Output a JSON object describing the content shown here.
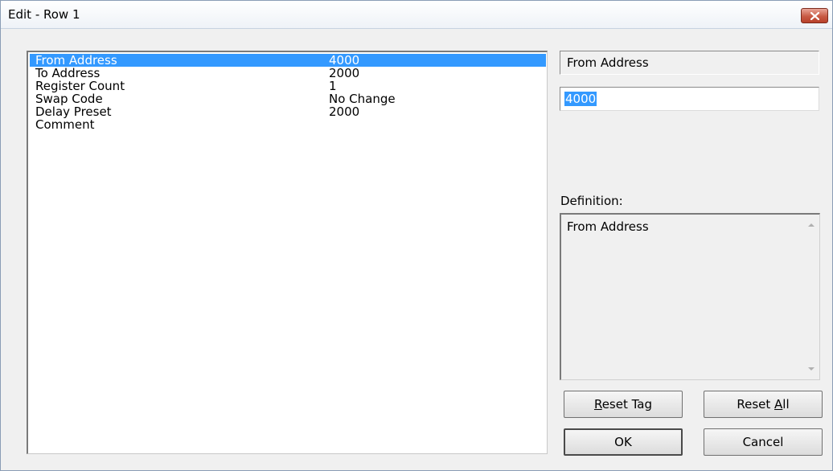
{
  "window": {
    "title": "Edit - Row 1"
  },
  "icons": {
    "close": "close-icon",
    "scroll_up": "scroll-up-arrow-icon",
    "scroll_down": "scroll-down-arrow-icon"
  },
  "colors": {
    "selection": "#3399ff",
    "close_button": "#c85a44"
  },
  "list": {
    "rows": [
      {
        "name": "From Address",
        "value": "4000",
        "selected": true
      },
      {
        "name": "To Address",
        "value": "2000",
        "selected": false
      },
      {
        "name": "Register Count",
        "value": "1",
        "selected": false
      },
      {
        "name": "Swap Code",
        "value": "No Change",
        "selected": false
      },
      {
        "name": "Delay Preset",
        "value": "2000",
        "selected": false
      },
      {
        "name": "Comment",
        "value": "",
        "selected": false
      }
    ]
  },
  "editor": {
    "field_name": "From Address",
    "field_value": "4000",
    "definition_label": "Definition:",
    "definition_text": "From Address"
  },
  "buttons": {
    "reset_tag": {
      "mnemonic": "R",
      "rest": "eset Tag"
    },
    "reset_all": {
      "pre": "Reset ",
      "mnemonic": "A",
      "rest": "ll"
    },
    "ok": "OK",
    "cancel": "Cancel"
  }
}
